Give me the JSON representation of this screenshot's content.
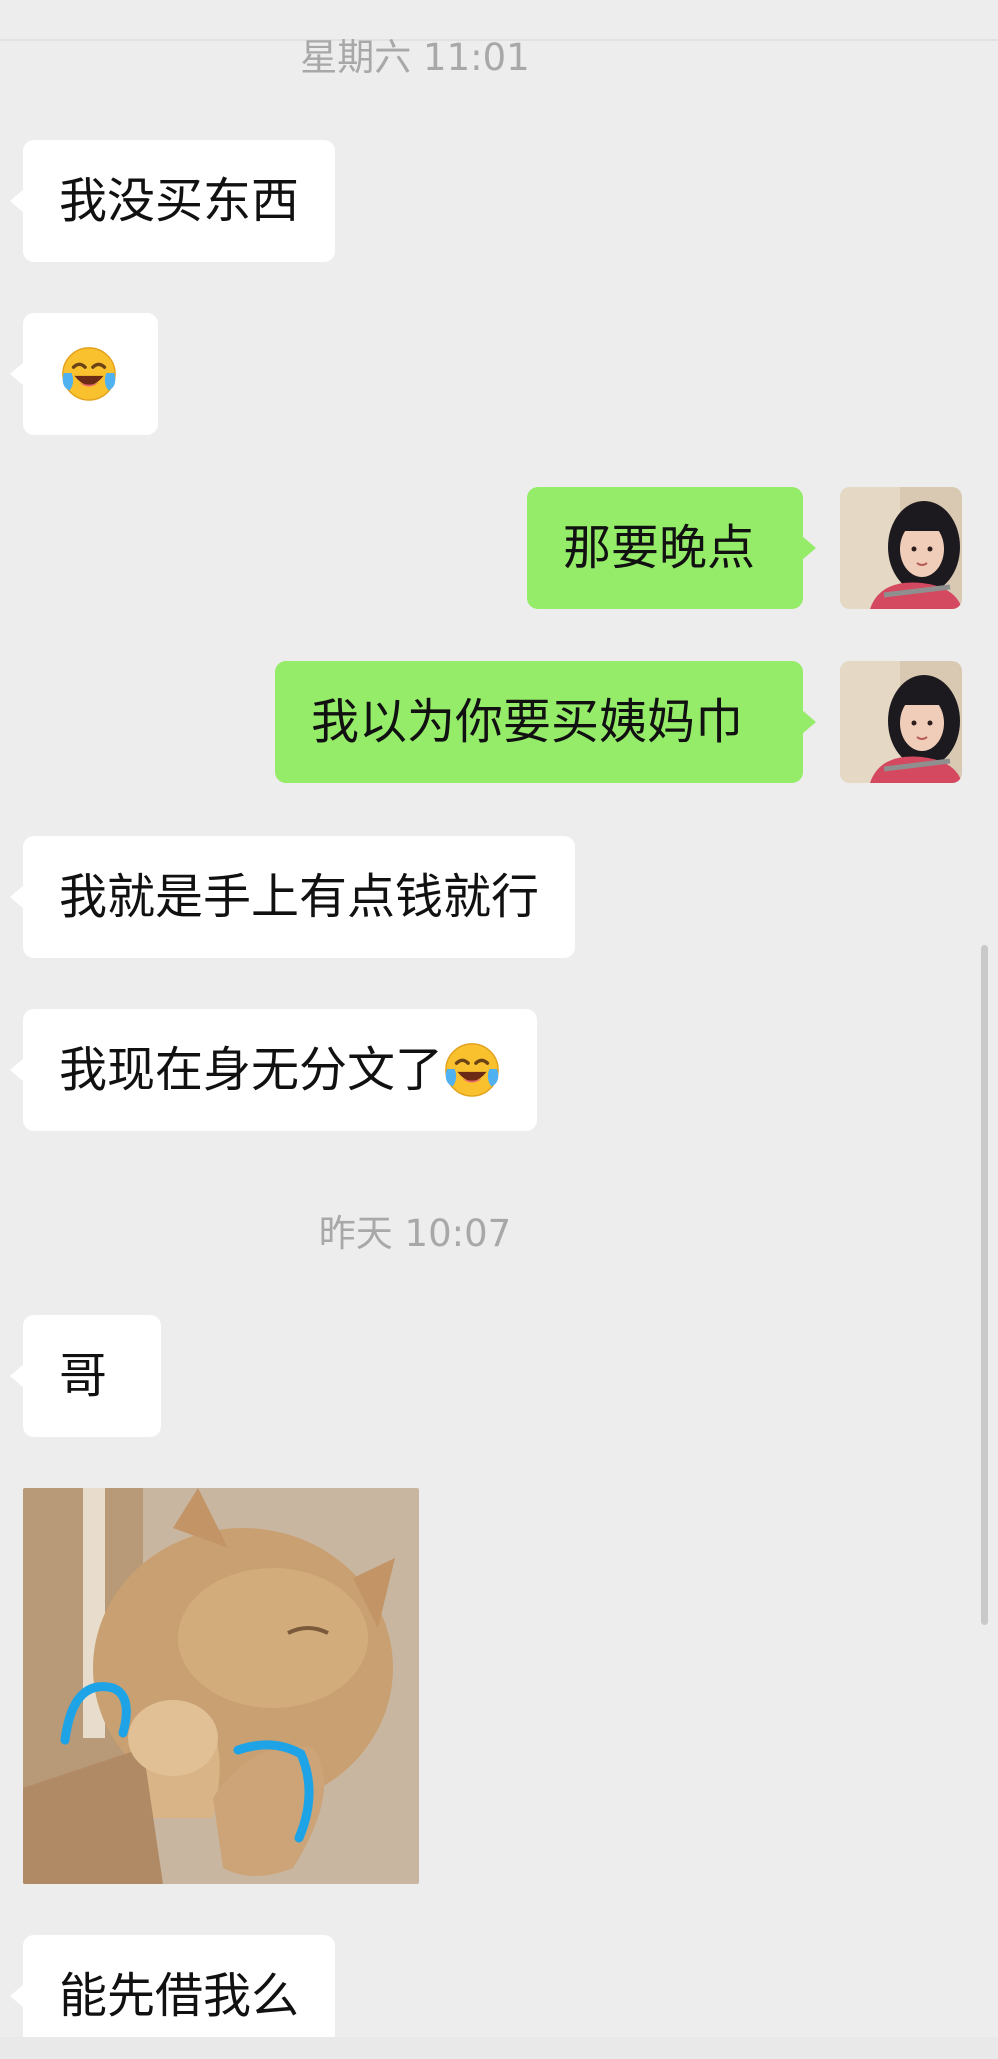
{
  "timestamps": {
    "first": "星期六 11:01",
    "second": "昨天 10:07"
  },
  "messages": {
    "m1": "我没买东西",
    "m3": "那要晚点",
    "m4": "我以为你要买姨妈巾",
    "m5": "我就是手上有点钱就行",
    "m6": "我现在身无分文了",
    "m7": "哥",
    "m9": "能先借我么"
  },
  "emoji": {
    "m2": "laugh-cry-emoji",
    "m6_trailing": "laugh-cry-emoji"
  },
  "sticker": {
    "name": "crying-cat-sticker"
  },
  "colors": {
    "background": "#ededed",
    "incoming_bubble": "#ffffff",
    "outgoing_bubble": "#95ec69",
    "timestamp": "#a8a8a8"
  }
}
